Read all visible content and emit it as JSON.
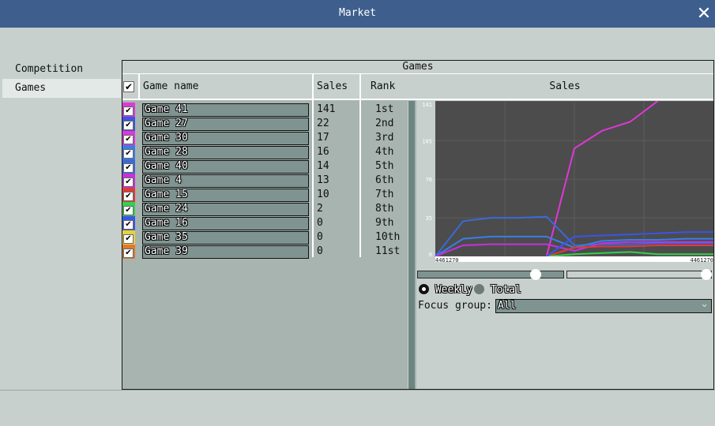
{
  "window": {
    "title": "Market",
    "close_glyph": "✕"
  },
  "sidebar": {
    "items": [
      {
        "label": "Competition"
      },
      {
        "label": "Games"
      }
    ]
  },
  "panel": {
    "title": "Games",
    "columns": {
      "name": "Game name",
      "sales": "Sales",
      "rank": "Rank"
    },
    "rows": [
      {
        "name": "Game 41",
        "sales": "141",
        "rank": "1st",
        "color": "#e037d6"
      },
      {
        "name": "Game 27",
        "sales": "22",
        "rank": "2nd",
        "color": "#3a55e8"
      },
      {
        "name": "Game 30",
        "sales": "17",
        "rank": "3rd",
        "color": "#e037d6"
      },
      {
        "name": "Game 28",
        "sales": "16",
        "rank": "4th",
        "color": "#3a7ee8"
      },
      {
        "name": "Game 40",
        "sales": "14",
        "rank": "5th",
        "color": "#3a6ad8"
      },
      {
        "name": "Game 4",
        "sales": "13",
        "rank": "6th",
        "color": "#c431e0"
      },
      {
        "name": "Game 15",
        "sales": "10",
        "rank": "7th",
        "color": "#e03a3a"
      },
      {
        "name": "Game 24",
        "sales": "2",
        "rank": "8th",
        "color": "#36d04a"
      },
      {
        "name": "Game 16",
        "sales": "0",
        "rank": "9th",
        "color": "#3a55e8"
      },
      {
        "name": "Game 35",
        "sales": "0",
        "rank": "10th",
        "color": "#e8d23a"
      },
      {
        "name": "Game 39",
        "sales": "0",
        "rank": "11st",
        "color": "#e0782e"
      }
    ],
    "check_glyph": "✔"
  },
  "chart": {
    "header": "Sales",
    "x_start_label": "4461270",
    "x_end_label": "4461270",
    "chart_data": {
      "type": "line",
      "title": "",
      "xlabel": "",
      "ylabel": "",
      "ylim": [
        0,
        141
      ],
      "y_ticks": [
        "0",
        "35",
        "70",
        "105",
        "141"
      ],
      "x": [
        0,
        1,
        2,
        3,
        4,
        5,
        6,
        7,
        8,
        9,
        10
      ],
      "series": [
        {
          "color": "#e037d6",
          "values": [
            null,
            null,
            null,
            null,
            0,
            98,
            114,
            122,
            141,
            null,
            null
          ]
        },
        {
          "color": "#3a6ad8",
          "values": [
            0,
            32,
            35,
            35,
            36,
            10,
            11,
            11,
            12,
            12,
            12
          ]
        },
        {
          "color": "#3a7ee8",
          "values": [
            0,
            16,
            18,
            18,
            18,
            8,
            14,
            15,
            15,
            16,
            16
          ]
        },
        {
          "color": "#c431e0",
          "values": [
            0,
            10,
            11,
            11,
            11,
            5,
            12,
            13,
            13,
            13,
            13
          ]
        },
        {
          "color": "#e03a3a",
          "values": [
            null,
            null,
            null,
            null,
            0,
            8,
            9,
            9,
            10,
            10,
            10
          ]
        },
        {
          "color": "#36d04a",
          "values": [
            null,
            null,
            null,
            null,
            0,
            2,
            3,
            4,
            2,
            2,
            2
          ]
        },
        {
          "color": "#3a55e8",
          "values": [
            null,
            null,
            null,
            null,
            0,
            18,
            19,
            20,
            21,
            22,
            22
          ]
        }
      ],
      "grid": true
    }
  },
  "controls": {
    "slider_left_value": 0.8,
    "slider_right_value": 1.0,
    "weekly_label": "Weekly",
    "total_label": "Total",
    "focus_label": "Focus group:",
    "focus_value": "All",
    "chevron_glyph": "⌄"
  }
}
